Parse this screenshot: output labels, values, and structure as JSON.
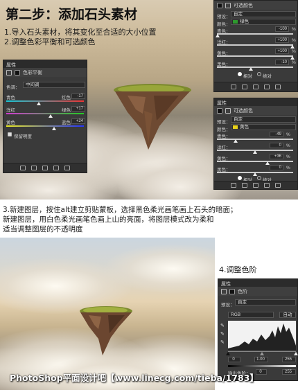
{
  "top": {
    "title": "第二步：添加石头素材",
    "line1": "1.导入石头素材，将其变化至合适的大小位置",
    "line2": "2.调整色彩平衡和可选颜色"
  },
  "color_balance_panel": {
    "header": "属性",
    "tool_label": "色彩平衡",
    "tone_label": "色调：",
    "tone_value": "中间调",
    "rows": [
      {
        "left": "青色",
        "right": "红色",
        "value": "-17"
      },
      {
        "left": "洋红",
        "right": "绿色",
        "value": "+17"
      },
      {
        "left": "黄色",
        "right": "蓝色",
        "value": "+24"
      }
    ],
    "preserve_label": "保留明度"
  },
  "selective_color_1": {
    "header": "属性",
    "tool_label": "可选颜色",
    "preset_label": "预设：",
    "preset_value": "自定",
    "color_label": "颜色：",
    "color_value": "绿色",
    "color_swatch": "#2e9a2e",
    "rows": [
      {
        "label": "青色：",
        "value": "-100",
        "unit": "%"
      },
      {
        "label": "洋红：",
        "value": "+100",
        "unit": "%"
      },
      {
        "label": "黄色：",
        "value": "+100",
        "unit": "%"
      },
      {
        "label": "黑色：",
        "value": "-10",
        "unit": "%"
      }
    ],
    "radio_relative": "相对",
    "radio_absolute": "绝对"
  },
  "selective_color_2": {
    "header": "属性",
    "tool_label": "可选颜色",
    "preset_label": "预设：",
    "preset_value": "自定",
    "color_label": "颜色：",
    "color_value": "黄色",
    "color_swatch": "#e8d21a",
    "rows": [
      {
        "label": "青色：",
        "value": "-49",
        "unit": "%"
      },
      {
        "label": "洋红：",
        "value": "0",
        "unit": "%"
      },
      {
        "label": "黄色：",
        "value": "+36",
        "unit": "%"
      },
      {
        "label": "黑色：",
        "value": "0",
        "unit": "%"
      }
    ],
    "radio_relative": "相对",
    "radio_absolute": "绝对"
  },
  "middle": {
    "line1": "3.新建图层，按住alt建立剪贴蒙板，选择黑色柔光画笔画上石头的暗面；",
    "line2": "新建图层，用白色柔光画笔色画上山的亮面，将图层模式改为柔和",
    "line3": "适当调整图层的不透明度"
  },
  "step4_label": "4.调整色阶",
  "levels_panel": {
    "header": "属性",
    "tool_label": "色阶",
    "preset_label": "预设：",
    "preset_value": "自定",
    "channel_value": "RGB",
    "auto_button": "自动",
    "input_black": "0",
    "input_gamma": "1.00",
    "input_white": "255",
    "output_label": "输出色阶：",
    "output_black": "0",
    "output_white": "255"
  },
  "watermark": "PhotoShop平面设计吧【www.linecg.com/tieba/1783】"
}
